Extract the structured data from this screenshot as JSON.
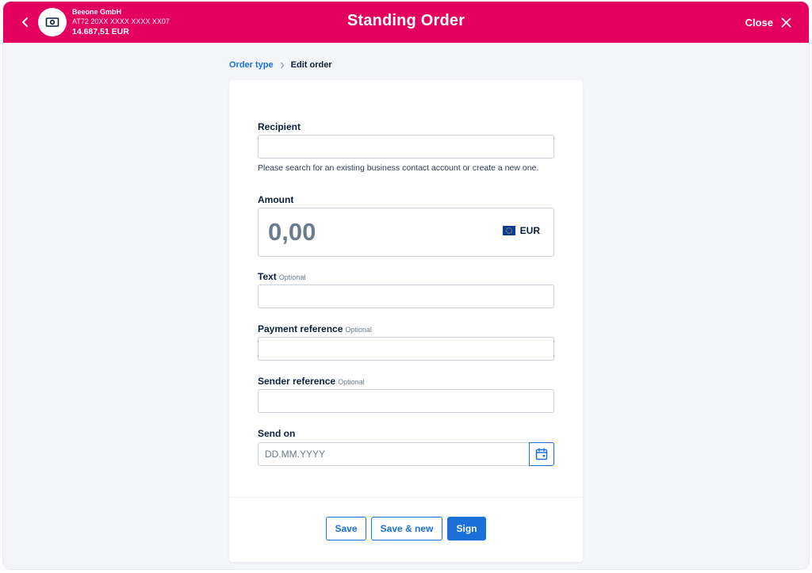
{
  "header": {
    "title": "Standing Order",
    "close_label": "Close",
    "account": {
      "name": "Beeone GmbH",
      "iban": "AT72 20XX XXXX XXXX XX07",
      "balance": "14.687,51 EUR"
    }
  },
  "breadcrumb": {
    "step1": "Order type",
    "step2": "Edit order"
  },
  "form": {
    "recipient": {
      "label": "Recipient",
      "value": "",
      "hint": "Please search for an existing business contact account or create a new one."
    },
    "amount": {
      "label": "Amount",
      "value": "0,00",
      "currency": "EUR"
    },
    "text": {
      "label": "Text",
      "optional": "Optional",
      "value": ""
    },
    "payment_reference": {
      "label": "Payment reference",
      "optional": "Optional",
      "value": ""
    },
    "sender_reference": {
      "label": "Sender reference",
      "optional": "Optional",
      "value": ""
    },
    "send_on": {
      "label": "Send on",
      "placeholder": "DD.MM.YYYY",
      "value": ""
    }
  },
  "actions": {
    "save": "Save",
    "save_new": "Save & new",
    "sign": "Sign"
  },
  "colors": {
    "brand": "#e3005f",
    "accent": "#1a6fd9",
    "background": "#f3f5f8"
  }
}
